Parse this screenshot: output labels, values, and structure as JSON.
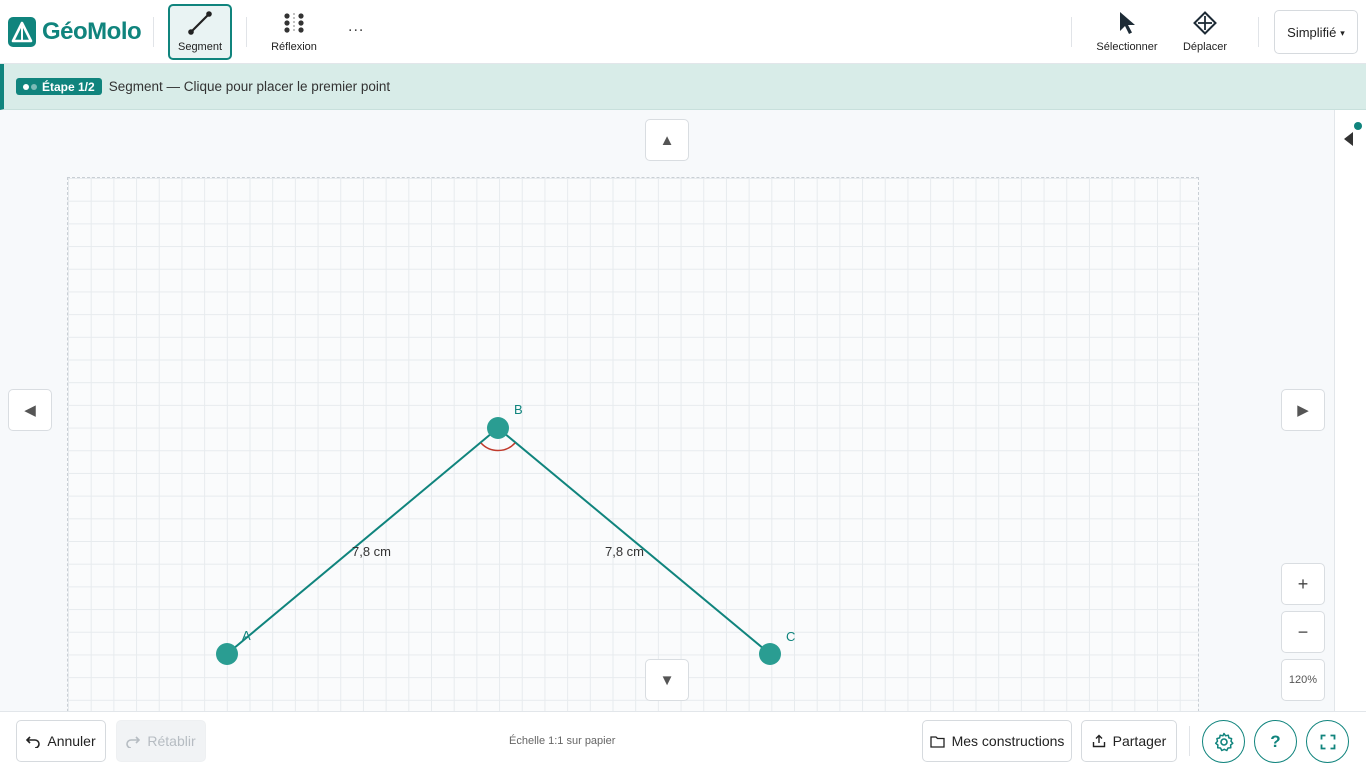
{
  "app": {
    "name": "GéoMolo"
  },
  "toolbar": {
    "segment_label": "Segment",
    "reflexion_label": "Réflexion",
    "more_label": "...",
    "select_label": "Sélectionner",
    "move_label": "Déplacer",
    "mode_label": "Simplifié"
  },
  "step": {
    "badge": "Étape 1/2",
    "text": "Segment — Clique pour placer le premier point"
  },
  "figure": {
    "points": [
      {
        "name": "A",
        "label": "A"
      },
      {
        "name": "B",
        "label": "B"
      },
      {
        "name": "C",
        "label": "C"
      }
    ],
    "segments": [
      {
        "from": "A",
        "to": "B",
        "length_label": "7,8 cm"
      },
      {
        "from": "B",
        "to": "C",
        "length_label": "7,8 cm"
      }
    ],
    "angle_mark_at": "B"
  },
  "zoom": {
    "in": "+",
    "out": "−",
    "level": "120%"
  },
  "bottom": {
    "undo": "Annuler",
    "redo": "Rétablir",
    "scale": "Échelle 1:1 sur papier",
    "constructions": "Mes constructions",
    "share": "Partager"
  },
  "colors": {
    "accent": "#10847d",
    "point_fill": "#2a9d92",
    "angle_mark": "#c0392b",
    "step_band": "#d8ece8"
  },
  "icons": {
    "undo": "undo-icon",
    "redo": "redo-icon",
    "folder": "folder-icon",
    "share": "share-icon",
    "settings": "gear-icon",
    "help": "question-icon",
    "fullscreen": "fullscreen-icon"
  }
}
